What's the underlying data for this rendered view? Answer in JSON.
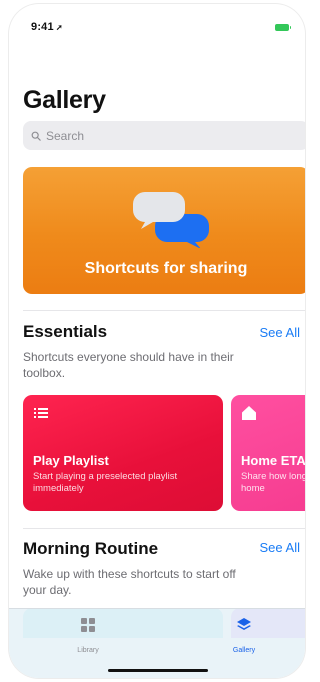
{
  "status_bar": {
    "time": "9:41",
    "location_arrow": "➚"
  },
  "page_title": "Gallery",
  "search": {
    "placeholder": "Search"
  },
  "hero": {
    "label": "Shortcuts for sharing",
    "icon": "chat-bubbles-icon",
    "color": "#ef8a1b"
  },
  "sections": [
    {
      "title": "Essentials",
      "see_all": "See All",
      "description": "Shortcuts everyone should have in their toolbox.",
      "cards": [
        {
          "title": "Play Playlist",
          "subtitle": "Start playing a preselected playlist immediately",
          "icon": "list-icon",
          "color": "#e8103a"
        },
        {
          "title": "Home ETA",
          "subtitle": "Share how long to get home",
          "icon": "house-icon",
          "color": "#f53b8f"
        }
      ]
    },
    {
      "title": "Morning Routine",
      "see_all": "See All",
      "description": "Wake up with these shortcuts to start off your day."
    }
  ],
  "tab_bar": {
    "tabs": [
      {
        "label": "Library",
        "icon": "grid-icon",
        "selected": false
      },
      {
        "label": "Gallery",
        "icon": "layers-icon",
        "selected": true
      }
    ]
  },
  "colors": {
    "accent": "#1a7cf5",
    "battery": "#33c759"
  }
}
